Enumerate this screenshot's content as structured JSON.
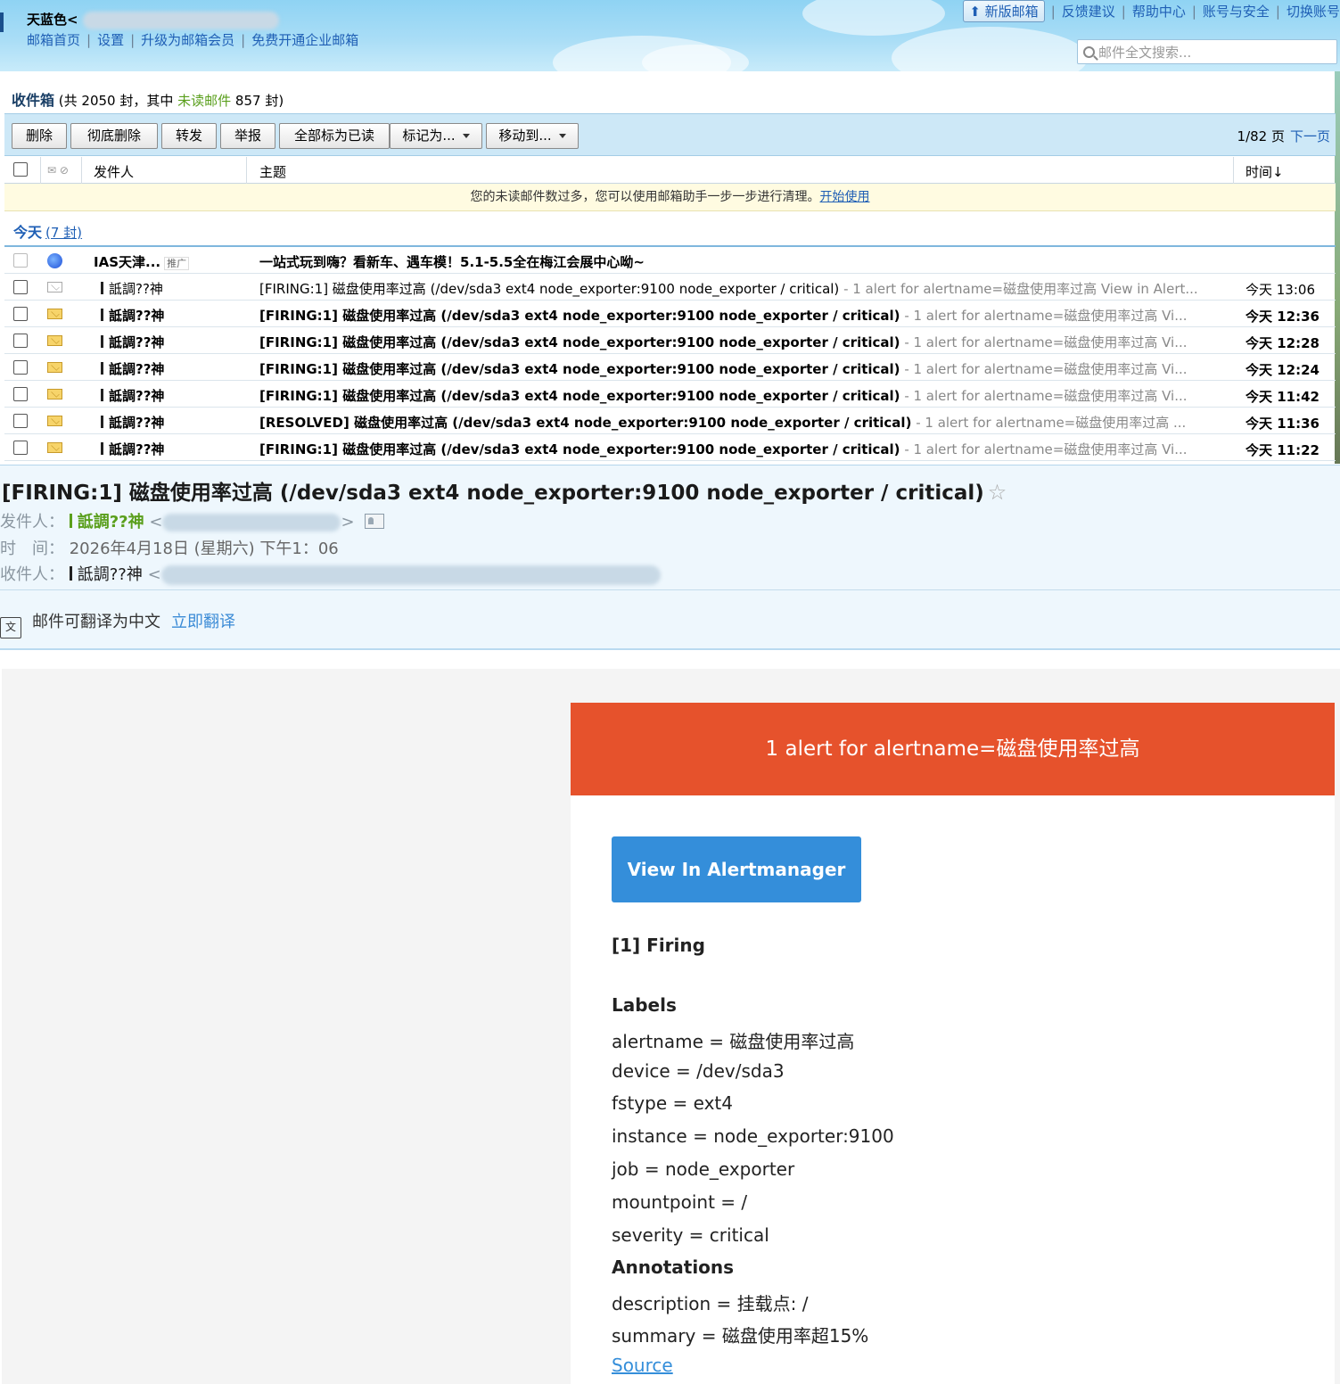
{
  "header": {
    "account_name": "天蓝色<",
    "links": [
      "邮箱首页",
      "设置",
      "升级为邮箱会员",
      "免费开通企业邮箱"
    ],
    "new_version_label": "新版邮箱",
    "right_links": [
      "反馈建议",
      "帮助中心",
      "账号与安全",
      "切换账号"
    ],
    "search_placeholder": "邮件全文搜索..."
  },
  "inbox": {
    "title": "收件箱",
    "summary_prefix": "(共 2050 封，其中 ",
    "unread_label": "未读邮件",
    "summary_suffix": " 857 封)"
  },
  "toolbar": {
    "buttons": [
      "删除",
      "彻底删除",
      "转发",
      "举报",
      "全部标为已读",
      "标记为...",
      "移动到..."
    ],
    "page_info": "1/82 页",
    "next_page": "下一页"
  },
  "columns": {
    "sender": "发件人",
    "subject": "主题",
    "time": "时间↓"
  },
  "notice": {
    "text": "您的未读邮件数过多，您可以使用邮箱助手一步一步进行清理。",
    "link": "开始使用"
  },
  "group": {
    "label": "今天",
    "count": "(7 封)"
  },
  "mails": [
    {
      "sender": "IAS天津...",
      "tag": "推广",
      "subject": "一站式玩到嗨？看新车、遇车模！5.1-5.5全在梅江会展中心呦~",
      "summary": "",
      "time": ""
    },
    {
      "sender": "詆調??神",
      "subject": "[FIRING:1] 磁盘使用率过高 (/dev/sda3 ext4 node_exporter:9100 node_exporter / critical)",
      "summary": " - 1 alert for alertname=磁盘使用率过高 View in Alert...",
      "time": "今天 13:06"
    },
    {
      "sender": "詆調??神",
      "subject": "[FIRING:1] 磁盘使用率过高 (/dev/sda3 ext4 node_exporter:9100 node_exporter / critical)",
      "summary": " - 1 alert for alertname=磁盘使用率过高 Vi...",
      "time": "今天 12:36"
    },
    {
      "sender": "詆調??神",
      "subject": "[FIRING:1] 磁盘使用率过高 (/dev/sda3 ext4 node_exporter:9100 node_exporter / critical)",
      "summary": " - 1 alert for alertname=磁盘使用率过高 Vi...",
      "time": "今天 12:28"
    },
    {
      "sender": "詆調??神",
      "subject": "[FIRING:1] 磁盘使用率过高 (/dev/sda3 ext4 node_exporter:9100 node_exporter / critical)",
      "summary": " - 1 alert for alertname=磁盘使用率过高 Vi...",
      "time": "今天 12:24"
    },
    {
      "sender": "詆調??神",
      "subject": "[FIRING:1] 磁盘使用率过高 (/dev/sda3 ext4 node_exporter:9100 node_exporter / critical)",
      "summary": " - 1 alert for alertname=磁盘使用率过高 Vi...",
      "time": "今天 11:42"
    },
    {
      "sender": "詆調??神",
      "subject": "[RESOLVED] 磁盘使用率过高 (/dev/sda3 ext4 node_exporter:9100 node_exporter / critical)",
      "summary": " - 1 alert for alertname=磁盘使用率过高 ...",
      "time": "今天 11:36"
    },
    {
      "sender": "詆調??神",
      "subject": "[FIRING:1] 磁盘使用率过高 (/dev/sda3 ext4 node_exporter:9100 node_exporter / critical)",
      "summary": " - 1 alert for alertname=磁盘使用率过高 Vi...",
      "time": "今天 11:22"
    }
  ],
  "reading": {
    "title": "[FIRING:1] 磁盘使用率过高 (/dev/sda3 ext4 node_exporter:9100 node_exporter / critical)",
    "from_label": "发件人：",
    "from_name": "詆調??神",
    "time_label": "时　间：",
    "time_value": "2026年4月18日 (星期六) 下午1：06",
    "to_label": "收件人：",
    "to_name": "詆調??神",
    "translate_text": "邮件可翻译为中文",
    "translate_link": "立即翻译"
  },
  "alert": {
    "header": "1 alert for alertname=磁盘使用率过高",
    "button": "View In Alertmanager",
    "firing": "[1] Firing",
    "labels_title": "Labels",
    "labels": [
      "alertname = 磁盘使用率过高",
      "device = /dev/sda3",
      "fstype = ext4",
      "instance = node_exporter:9100",
      "job = node_exporter",
      "mountpoint = /",
      "severity = critical"
    ],
    "annotations_title": "Annotations",
    "annotations": [
      "description = 挂载点: /",
      "summary = 磁盘使用率超15%"
    ],
    "source": "Source"
  }
}
